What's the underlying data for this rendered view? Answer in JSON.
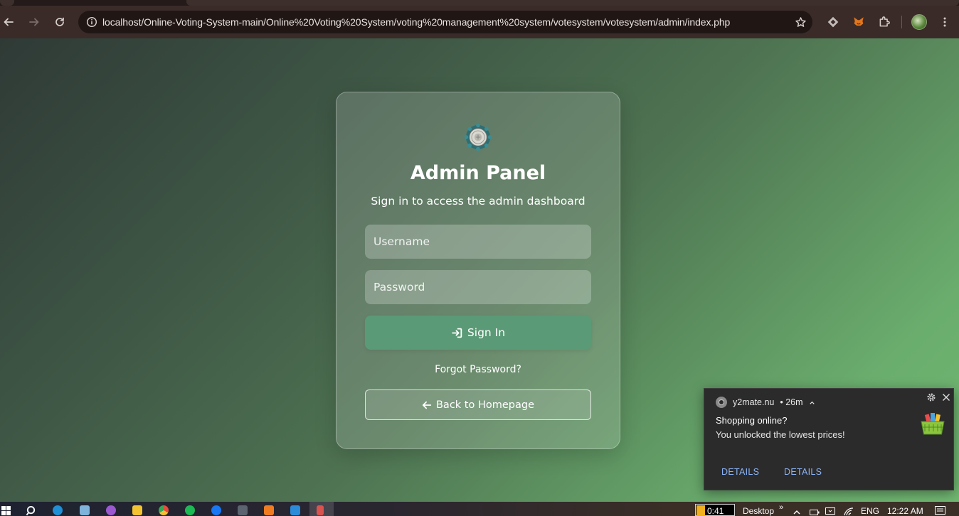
{
  "browser": {
    "url": "localhost/Online-Voting-System-main/Online%20Voting%20System/voting%20management%20system/votesystem/votesystem/admin/index.php",
    "icons": [
      "back-arrow-icon",
      "forward-arrow-icon",
      "reload-icon",
      "site-info-icon",
      "bookmark-star-icon",
      "extension-diamond-icon",
      "metamask-fox-icon",
      "puzzle-extensions-icon",
      "profile-avatar",
      "kebab-menu-icon"
    ]
  },
  "login": {
    "title": "Admin Panel",
    "subtitle": "Sign in to access the admin dashboard",
    "username_placeholder": "Username",
    "password_placeholder": "Password",
    "signin_label": "Sign In",
    "forgot_label": "Forgot Password?",
    "back_label": "Back to Homepage",
    "colors": {
      "signin_button": "#5b9a76",
      "background_start": "#2f3a36",
      "background_end": "#71b872"
    }
  },
  "notification": {
    "source": "y2mate.nu",
    "age": "• 26m",
    "title": "Shopping online?",
    "body": "You unlocked the lowest prices!",
    "action1": "DETAILS",
    "action2": "DETAILS",
    "link_color": "#8ab4f8"
  },
  "taskbar": {
    "box_text": "0:41",
    "desktop_label": "Desktop",
    "language": "ENG",
    "time": "12:22 AM"
  }
}
